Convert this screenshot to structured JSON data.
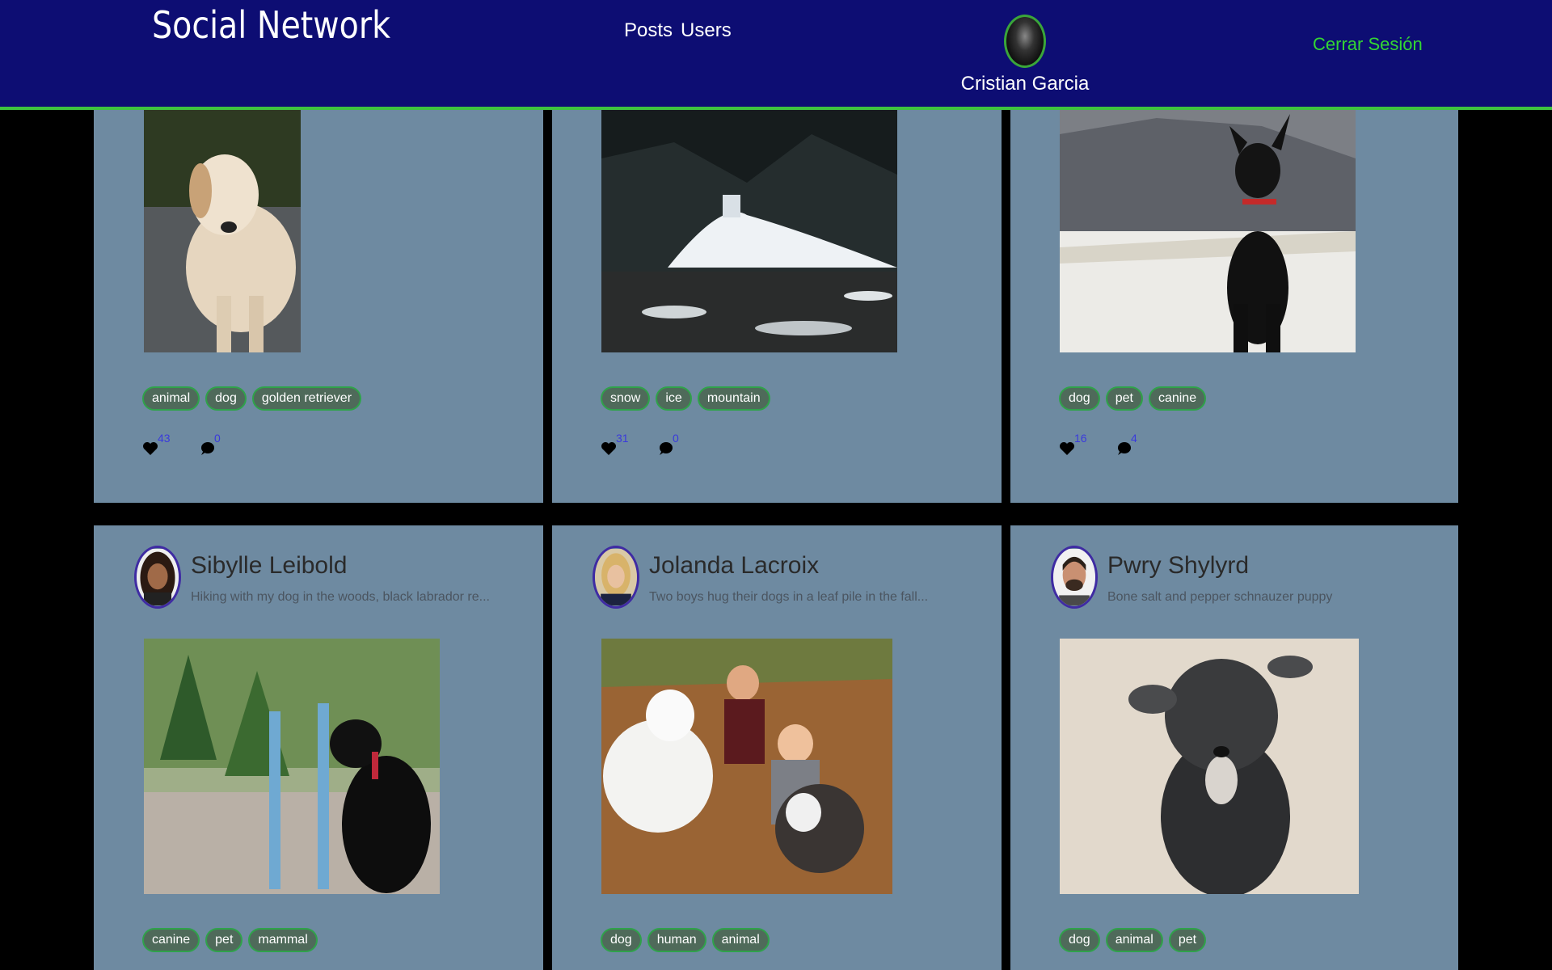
{
  "header": {
    "brand": "Social Network",
    "nav": [
      "Posts",
      "Users"
    ],
    "user_name": "Cristian Garcia",
    "logout": "Cerrar Sesión"
  },
  "posts": [
    {
      "tags": [
        "animal",
        "dog",
        "golden retriever"
      ],
      "likes": "43",
      "comments": "0"
    },
    {
      "tags": [
        "snow",
        "ice",
        "mountain"
      ],
      "likes": "31",
      "comments": "0"
    },
    {
      "tags": [
        "dog",
        "pet",
        "canine"
      ],
      "likes": "16",
      "comments": "4"
    },
    {
      "author": "Sibylle Leibold",
      "description": "Hiking with my dog in the woods, black labrador re...",
      "tags": [
        "canine",
        "pet",
        "mammal"
      ]
    },
    {
      "author": "Jolanda Lacroix",
      "description": "Two boys hug their dogs in a leaf pile in the fall...",
      "tags": [
        "dog",
        "human",
        "animal"
      ]
    },
    {
      "author": "Pwry Shylyrd",
      "description": "Bone salt and pepper schnauzer puppy",
      "tags": [
        "dog",
        "animal",
        "pet"
      ]
    }
  ],
  "icons": {
    "like": "heart-icon",
    "comment": "comment-bubble-icon"
  },
  "colors": {
    "header_bg": "#0d0d73",
    "accent_green": "#3ec33e",
    "card_bg": "#6e8aa1",
    "count_blue": "#3a3adc"
  }
}
